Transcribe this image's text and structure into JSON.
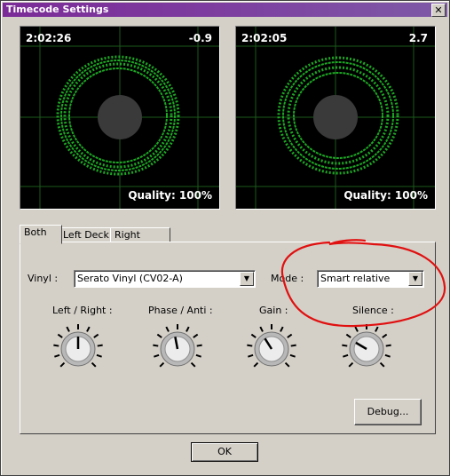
{
  "window": {
    "title": "Timecode Settings",
    "close_glyph": "✕"
  },
  "scopes": [
    {
      "time": "2:02:26",
      "value": "-0.9",
      "quality": "Quality: 100%"
    },
    {
      "time": "2:02:05",
      "value": "2.7",
      "quality": "Quality: 100%"
    }
  ],
  "tabs": [
    "Both",
    "Left Deck",
    "Right Deck"
  ],
  "settings": {
    "vinyl_label": "Vinyl :",
    "vinyl_value": "Serato Vinyl (CV02-A)",
    "mode_label": "Mode :",
    "mode_value": "Smart relative"
  },
  "knobs": [
    {
      "label": "Left / Right :",
      "level": 0.5
    },
    {
      "label": "Phase / Anti :",
      "level": 0.46
    },
    {
      "label": "Gain :",
      "level": 0.38
    },
    {
      "label": "Silence :",
      "level": 0.28
    }
  ],
  "buttons": {
    "debug": "Debug...",
    "ok": "OK"
  },
  "colors": {
    "titlebar": "#7b2b97",
    "scope_trace": "#22c42a",
    "annotation": "#e01010"
  }
}
